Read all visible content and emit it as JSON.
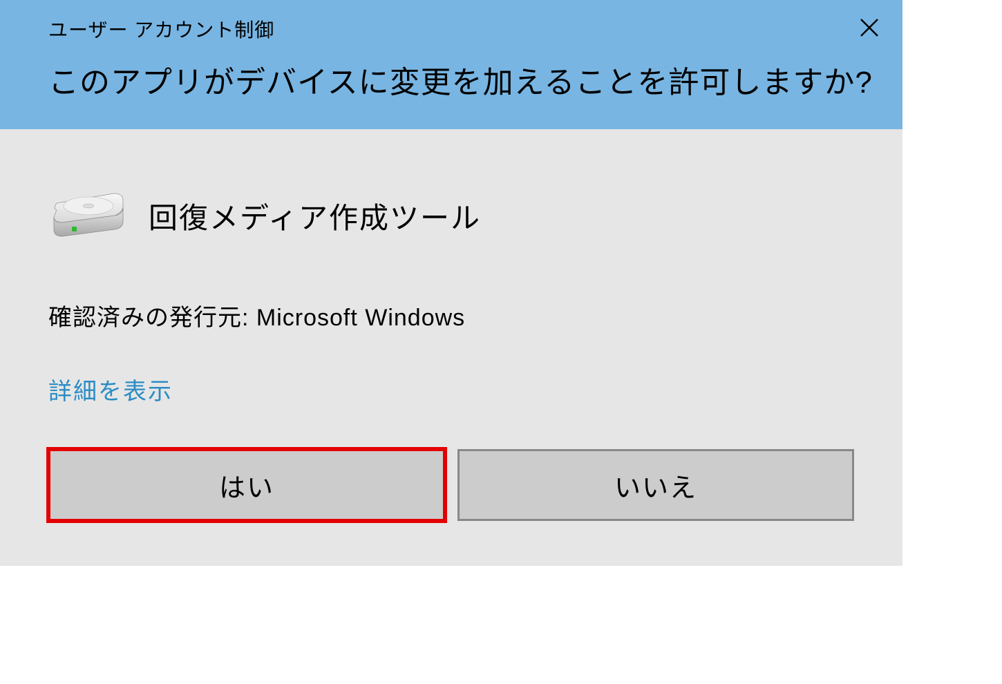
{
  "header": {
    "title": "ユーザー アカウント制御",
    "question": "このアプリがデバイスに変更を加えることを許可しますか?"
  },
  "body": {
    "app_name": "回復メディア作成ツール",
    "publisher_line": "確認済みの発行元: Microsoft Windows",
    "details_link": "詳細を表示"
  },
  "buttons": {
    "yes": "はい",
    "no": "いいえ"
  }
}
